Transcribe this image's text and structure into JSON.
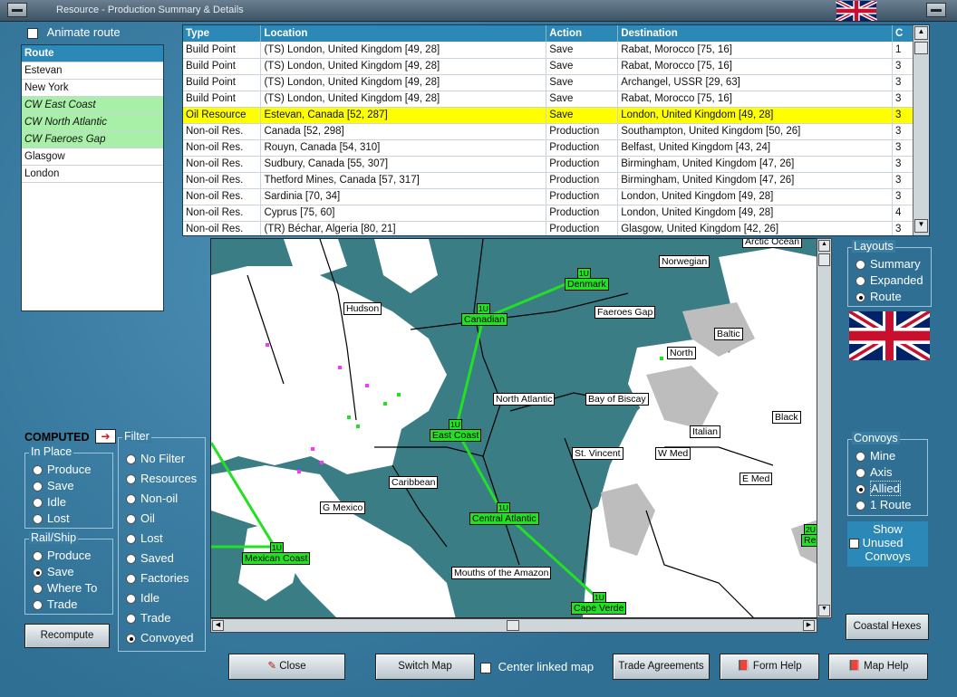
{
  "window": {
    "title": "Resource - Production Summary & Details"
  },
  "route_panel": {
    "animate_label": "Animate route",
    "header": "Route",
    "items": [
      {
        "label": "Estevan",
        "highlight": false
      },
      {
        "label": "New York",
        "highlight": false
      },
      {
        "label": "CW East Coast",
        "highlight": true
      },
      {
        "label": "CW North Atlantic",
        "highlight": true
      },
      {
        "label": "CW Faeroes Gap",
        "highlight": true
      },
      {
        "label": "Glasgow",
        "highlight": false
      },
      {
        "label": "London",
        "highlight": false
      }
    ]
  },
  "table": {
    "columns": [
      "Type",
      "Location",
      "Action",
      "Destination",
      "C"
    ],
    "rows": [
      {
        "type": "Build Point",
        "location": "(TS) London, United Kingdom [49, 28]",
        "action": "Save",
        "destination": "Rabat, Morocco [75, 16]",
        "c": "1",
        "color": "green",
        "highlight": false
      },
      {
        "type": "Build Point",
        "location": "(TS) London, United Kingdom [49, 28]",
        "action": "Save",
        "destination": "Rabat, Morocco [75, 16]",
        "c": "3",
        "color": "green",
        "highlight": false
      },
      {
        "type": "Build Point",
        "location": "(TS) London, United Kingdom [49, 28]",
        "action": "Save",
        "destination": "Archangel, USSR [29, 63]",
        "c": "3",
        "color": "green",
        "highlight": false
      },
      {
        "type": "Build Point",
        "location": "(TS) London, United Kingdom [49, 28]",
        "action": "Save",
        "destination": "Rabat, Morocco [75, 16]",
        "c": "3",
        "color": "black",
        "highlight": false
      },
      {
        "type": "Oil Resource",
        "location": "Estevan, Canada [52, 287]",
        "action": "Save",
        "destination": "London, United Kingdom [49, 28]",
        "c": "3",
        "color": "green",
        "highlight": true
      },
      {
        "type": "Non-oil Res.",
        "location": "Canada [52, 298]",
        "action": "Production",
        "destination": "Southampton, United Kingdom [50, 26]",
        "c": "3",
        "color": "black",
        "highlight": false
      },
      {
        "type": "Non-oil Res.",
        "location": "Rouyn, Canada [54, 310]",
        "action": "Production",
        "destination": "Belfast, United Kingdom [43, 24]",
        "c": "3",
        "color": "black",
        "highlight": false
      },
      {
        "type": "Non-oil Res.",
        "location": "Sudbury, Canada [55, 307]",
        "action": "Production",
        "destination": "Birmingham, United Kingdom [47, 26]",
        "c": "3",
        "color": "black",
        "highlight": false
      },
      {
        "type": "Non-oil Res.",
        "location": "Thetford Mines, Canada [57, 317]",
        "action": "Production",
        "destination": "Birmingham, United Kingdom [47, 26]",
        "c": "3",
        "color": "black",
        "highlight": false
      },
      {
        "type": "Non-oil Res.",
        "location": "Sardinia [70, 34]",
        "action": "Production",
        "destination": "London, United Kingdom [49, 28]",
        "c": "3",
        "color": "green",
        "highlight": false
      },
      {
        "type": "Non-oil Res.",
        "location": "Cyprus [75, 60]",
        "action": "Production",
        "destination": "London, United Kingdom [49, 28]",
        "c": "4",
        "color": "blue",
        "highlight": false
      },
      {
        "type": "Non-oil Res.",
        "location": "(TR) Béchar, Algeria [80, 21]",
        "action": "Production",
        "destination": "Glasgow, United Kingdom [42, 26]",
        "c": "3",
        "color": "black",
        "highlight": false
      }
    ]
  },
  "layouts": {
    "legend": "Layouts",
    "options": [
      "Summary",
      "Expanded",
      "Route"
    ],
    "selected": "Route"
  },
  "convoys": {
    "legend": "Convoys",
    "options": [
      "Mine",
      "Axis",
      "Allied",
      "1 Route"
    ],
    "selected": "Allied"
  },
  "show_unused": {
    "label": "Show Unused Convoys",
    "checked": true,
    "lines": [
      "Show",
      "Unused",
      "Convoys"
    ]
  },
  "computed": {
    "label": "COMPUTED"
  },
  "in_place": {
    "legend": "In Place",
    "options": [
      "Produce",
      "Save",
      "Idle",
      "Lost"
    ],
    "selected": ""
  },
  "rail_ship": {
    "legend": "Rail/Ship",
    "options": [
      "Produce",
      "Save",
      "Where To",
      "Trade"
    ],
    "selected": "Save"
  },
  "filter": {
    "legend": "Filter",
    "options": [
      "No Filter",
      "Resources",
      "Non-oil",
      "Oil",
      "Lost",
      "Saved",
      "Factories",
      "Idle",
      "Trade",
      "Convoyed"
    ],
    "selected": "Convoyed"
  },
  "buttons": {
    "recompute": "Recompute",
    "close": "Close",
    "switch_map": "Switch Map",
    "center_linked": "Center linked map",
    "trade_agreements": "Trade Agreements",
    "form_help": "Form Help",
    "map_help": "Map Help",
    "coastal_hexes": "Coastal Hexes"
  },
  "map": {
    "labels": {
      "arctic": "Arctic Ocean",
      "norwegian": "Norwegian",
      "hudson": "Hudson",
      "faeroes": "Faeroes Gap",
      "baltic": "Baltic",
      "north": "North",
      "north_atlantic": "North Atlantic",
      "biscay": "Bay of Biscay",
      "black": "Black",
      "italian": "Italian",
      "st_vincent": "St. Vincent",
      "w_med": "W Med",
      "e_med": "E Med",
      "caribbean": "Caribbean",
      "g_mexico": "G Mexico",
      "amazon": "Mouths of the Amazon"
    },
    "convoys": {
      "denmark": "Denmark",
      "canadian": "Canadian",
      "east_coast": "East Coast",
      "central_atlantic": "Central Atlantic",
      "mexican": "Mexican Coast",
      "cape_verde": "Cape Verde",
      "re": "Re"
    },
    "convoy_tag": "1U",
    "convoy_tag_re": "2U"
  },
  "colors": {
    "accent": "#2c88b6",
    "convoy": "#22e022",
    "sea": "#3a7d85",
    "highlight": "#ffff00"
  }
}
